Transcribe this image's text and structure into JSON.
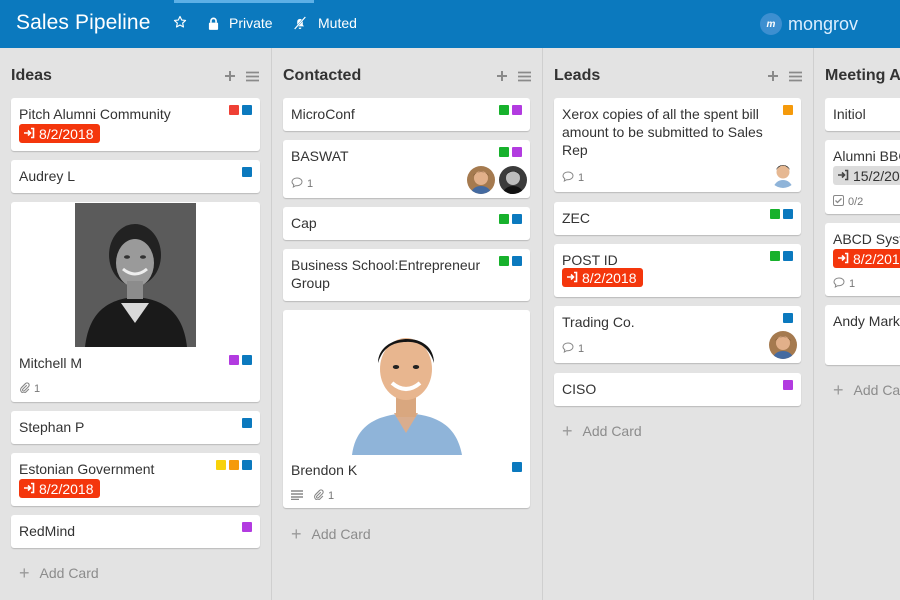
{
  "header": {
    "title": "Sales Pipeline",
    "private_label": "Private",
    "muted_label": "Muted",
    "brand": "mongrov",
    "brand_mark": "m"
  },
  "colors": {
    "header": "#0b79be",
    "label_red": "#ef4035",
    "label_blue": "#0b79be",
    "label_green": "#17b12c",
    "label_purple": "#b23be0",
    "label_orange": "#f59a0b",
    "label_yellow": "#f8d20a",
    "due_red": "#f4360c"
  },
  "common": {
    "add_card": "Add Card"
  },
  "lists": [
    {
      "title": "Ideas",
      "cards": [
        {
          "title": "Pitch Alumni Community",
          "labels": [
            "red",
            "blue"
          ],
          "due": "8/2/2018"
        },
        {
          "title": "Audrey L",
          "labels": [
            "blue"
          ]
        },
        {
          "title": "Mitchell M",
          "labels": [
            "purple",
            "blue"
          ],
          "attachments": "1",
          "cover": "woman-portrait"
        },
        {
          "title": "Stephan P",
          "labels": [
            "blue"
          ]
        },
        {
          "title": "Estonian Government",
          "labels": [
            "yellow",
            "orange",
            "blue"
          ],
          "due": "8/2/2018"
        },
        {
          "title": "RedMind",
          "labels": [
            "purple"
          ]
        }
      ]
    },
    {
      "title": "Contacted",
      "cards": [
        {
          "title": "MicroConf",
          "labels": [
            "green",
            "purple"
          ]
        },
        {
          "title": "BASWAT",
          "labels": [
            "green",
            "purple"
          ],
          "comments": "1"
        },
        {
          "title": "Cap",
          "labels": [
            "green",
            "blue"
          ]
        },
        {
          "title": "Business School:Entrepreneur",
          "title2": "Group",
          "labels": [
            "green",
            "blue"
          ]
        },
        {
          "title": "Brendon K",
          "labels": [
            "blue"
          ],
          "attachments": "1",
          "cover": "man-portrait"
        }
      ]
    },
    {
      "title": "Leads",
      "cards": [
        {
          "title": "Xerox copies of all the spent bill",
          "title2": "amount to be submitted to Sales",
          "title3": "Rep",
          "labels": [
            "orange"
          ],
          "comments": "1"
        },
        {
          "title": "ZEC",
          "labels": [
            "green",
            "blue"
          ]
        },
        {
          "title": "POST ID",
          "labels": [
            "green",
            "blue"
          ],
          "due": "8/2/2018"
        },
        {
          "title": "Trading Co.",
          "labels": [
            "blue"
          ],
          "comments": "1"
        },
        {
          "title": "CISO",
          "labels": [
            "purple"
          ]
        }
      ]
    },
    {
      "title": "Meeting A",
      "cards": [
        {
          "title": "Initiol"
        },
        {
          "title": "Alumni BBC",
          "due": "15/2/20",
          "checklist": "0/2"
        },
        {
          "title": "ABCD Syst",
          "due": "8/2/201",
          "comments": "1"
        },
        {
          "title": "Andy Mark"
        }
      ]
    }
  ]
}
